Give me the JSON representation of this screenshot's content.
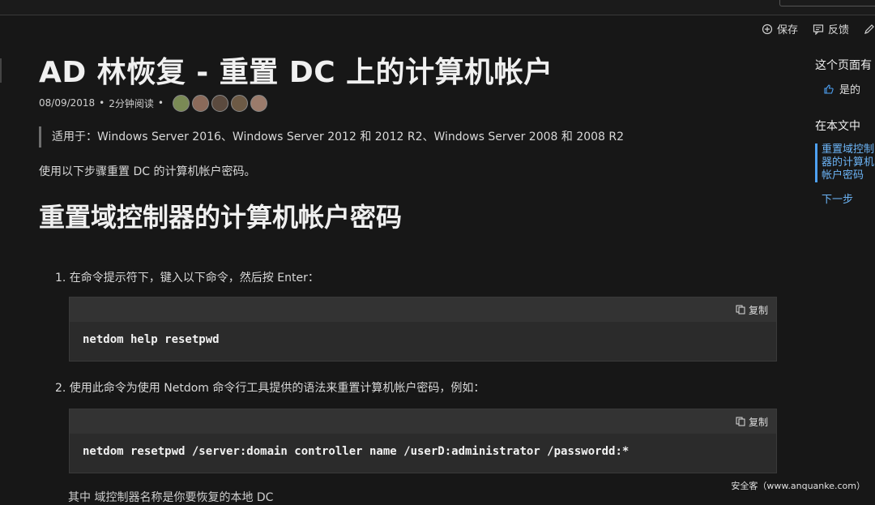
{
  "header": {
    "save_label": "保存",
    "feedback_label": "反馈"
  },
  "article": {
    "title": "AD 林恢复 - 重置 DC 上的计算机帐户",
    "date": "08/09/2018",
    "read_time": "2分钟阅读",
    "applies_to": "适用于：Windows Server 2016、Windows Server 2012 和 2012 R2、Windows Server 2008 和 2008 R2",
    "intro": "使用以下步骤重置 DC 的计算机帐户密码。",
    "section_heading": "重置域控制器的计算机帐户密码",
    "steps": [
      {
        "text": "1. 在命令提示符下，键入以下命令，然后按 Enter：",
        "code": "netdom help resetpwd",
        "copy_label": "复制"
      },
      {
        "text": "2. 使用此命令为使用 Netdom 命令行工具提供的语法来重置计算机帐户密码，例如：",
        "code": "netdom resetpwd /server:domain controller name /userD:administrator /passwordd:*",
        "copy_label": "复制"
      }
    ],
    "cut_text": "其中 域控制器名称是你要恢复的本地 DC"
  },
  "sidebar": {
    "feedback_question": "这个页面有",
    "yes_label": "是的",
    "toc_heading": "在本文中",
    "toc_items": [
      "重置域控制器的计算机帐户密码",
      "下一步"
    ]
  },
  "watermark": "安全客（www.anquanke.com）",
  "colors": {
    "background": "#171717",
    "link": "#6cb4f6",
    "code_bg": "#2b2b2b"
  }
}
